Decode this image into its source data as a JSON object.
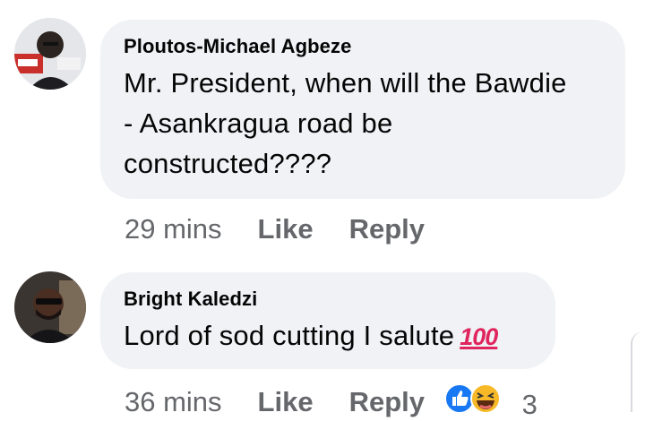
{
  "comments": [
    {
      "author": "Ploutos-Michael Agbeze",
      "text_lines": [
        "Mr. President, when will the Bawdie",
        "- Asankragua road be",
        "constructed????"
      ],
      "time": "29 mins",
      "like_label": "Like",
      "reply_label": "Reply"
    },
    {
      "author": "Bright Kaledzi",
      "text": "Lord of sod cutting I salute",
      "emoji": "100",
      "time": "36 mins",
      "like_label": "Like",
      "reply_label": "Reply",
      "reaction_icons": [
        "like-reaction-icon",
        "haha-reaction-icon"
      ],
      "reaction_count": "3"
    }
  ],
  "colors": {
    "bubble": "#f0f2f5",
    "text": "#050505",
    "meta": "#65676b",
    "like_blue": "#1877f2",
    "haha_yellow": "#f7b928",
    "emoji_red": "#e0245e"
  }
}
